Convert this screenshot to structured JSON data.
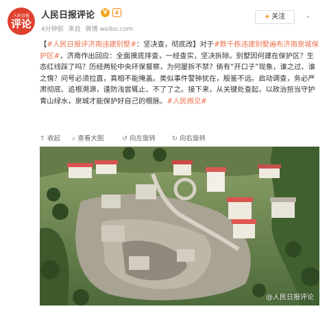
{
  "header": {
    "avatar_top": "人民日报",
    "avatar_main": "评论",
    "username": "人民日报评论",
    "verified_icon": "verified-badge-icon",
    "time": "4分钟前",
    "from": "来自",
    "source": "微博 weibo.com",
    "follow_label": "关注",
    "menu_icon": "chevron-down-icon"
  },
  "post": {
    "segments": [
      {
        "text": "【",
        "link": false
      },
      {
        "text": "#人民日报评济南违建别墅#",
        "link": true
      },
      {
        "text": "：坚决查，彻底改】对于",
        "link": false
      },
      {
        "text": "#数千栋违建别墅遍布济南泉城保护区#",
        "link": true
      },
      {
        "text": "，济南作出回应：全面摸底排查，一经查实，坚决拆除。别墅因何建在保护区？生态红线踩了吗？历经两轮中央环保督察，为何屡拆不禁？倘有“开口子”现象，谁之过、谁之惰？问号必须拉直，真相不能掩盖。类似事件警钟犹在，殷鉴不远。启动调查，务必严肃彻底、追根溯源，谨防浅尝辄止、不了了之。接下来，从关键处查起，以政治担当守护青山绿水，泉城才能保护好自己的根脉。",
        "link": false
      },
      {
        "text": "#人民微见#",
        "link": true
      }
    ]
  },
  "actions": {
    "collapse": "收起",
    "view_original": "查看大图",
    "rotate_left": "向左旋转",
    "rotate_right": "向右旋转"
  },
  "photo": {
    "watermark": "@人民日报评论"
  },
  "colors": {
    "link": "#eb7350",
    "avatar_bg": "#e0402f",
    "follow_plus": "#ff8200"
  }
}
